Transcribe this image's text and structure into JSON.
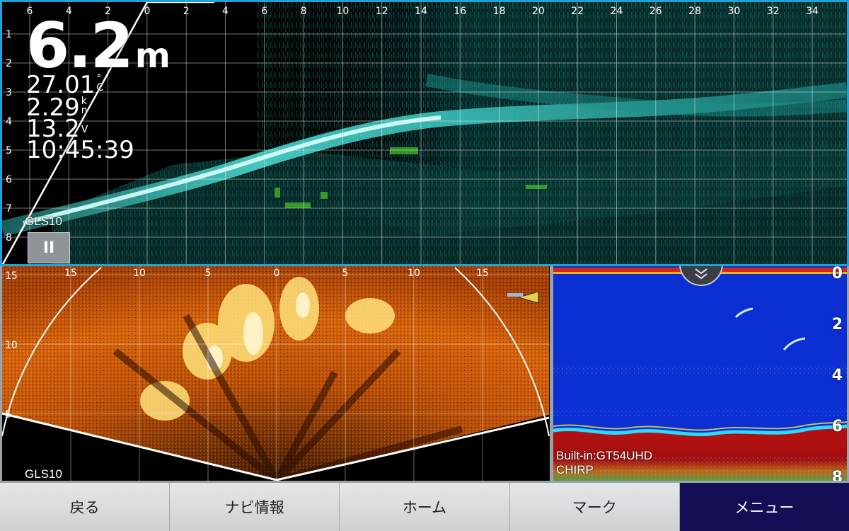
{
  "top": {
    "x_ticks": [
      "6",
      "4",
      "2",
      "0",
      "2",
      "4",
      "6",
      "8",
      "10",
      "12",
      "14",
      "16",
      "18",
      "20",
      "22",
      "24",
      "26",
      "28",
      "30",
      "32",
      "34"
    ],
    "y_ticks": [
      "1",
      "2",
      "3",
      "4",
      "5",
      "6",
      "7",
      "8"
    ],
    "depth_value": "6.2",
    "depth_unit": "m",
    "water_temp": "27.01",
    "water_temp_unit_top": "°",
    "water_temp_unit_bottom": "C",
    "speed": "2.29",
    "speed_unit_top": "k",
    "speed_unit_bottom": "n",
    "voltage": "13.2",
    "voltage_unit": "V",
    "time": "10:45:39",
    "source_label": "GLS10",
    "pause_label": "II"
  },
  "live": {
    "x_ticks": [
      "15",
      "10",
      "5",
      "0",
      "5",
      "10",
      "15"
    ],
    "y_ticks": [
      "15",
      "10",
      "5"
    ],
    "source_label": "GLS10"
  },
  "sonar": {
    "depth_scale": [
      "0",
      "2",
      "4",
      "6",
      "8"
    ],
    "source_label": "Built-in:GT54UHD",
    "mode_label": "CHIRP",
    "collapse_icon": "double-chevron-down-icon"
  },
  "nav": {
    "back": "戻る",
    "navi_info": "ナビ情報",
    "home": "ホーム",
    "mark": "マーク",
    "menu": "メニュー"
  },
  "colors": {
    "top_border": "#1ea3d8",
    "active_tab": "#130e56",
    "sonar_bg": "#0b2fd2"
  }
}
